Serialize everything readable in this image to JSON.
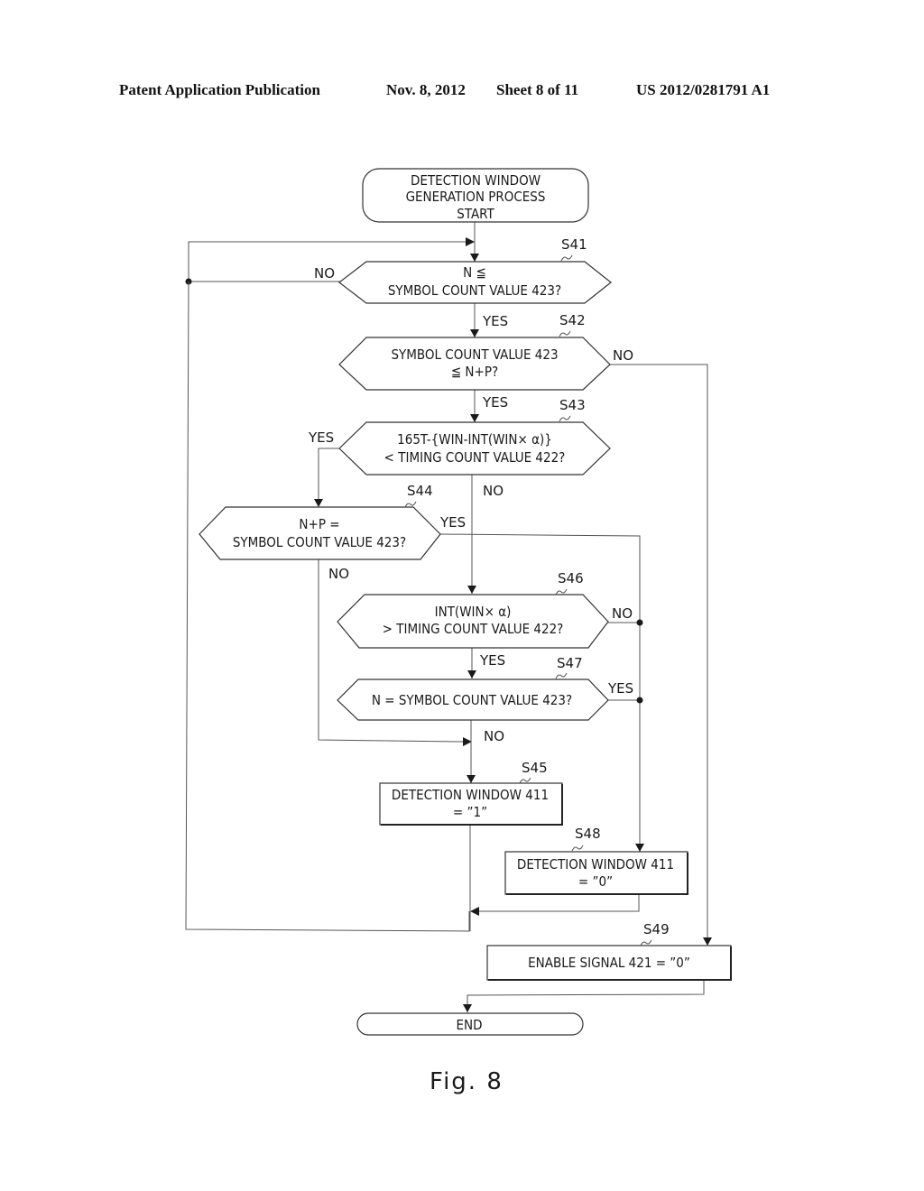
{
  "header": {
    "publication": "Patent Application Publication",
    "date": "Nov. 8, 2012",
    "sheet": "Sheet 8 of 11",
    "number": "US 2012/0281791 A1"
  },
  "flowchart": {
    "start": {
      "lines": [
        "DETECTION WINDOW",
        "GENERATION PROCESS",
        "START"
      ]
    },
    "steps": {
      "s41": {
        "id": "S41",
        "lines": [
          "N ≦",
          "SYMBOL COUNT VALUE 423?"
        ]
      },
      "s42": {
        "id": "S42",
        "lines": [
          "SYMBOL COUNT VALUE 423",
          "≦ N+P?"
        ]
      },
      "s43": {
        "id": "S43",
        "lines": [
          "165T-{WIN-INT(WIN× α)}",
          "< TIMING COUNT VALUE 422?"
        ]
      },
      "s44": {
        "id": "S44",
        "lines": [
          "N+P =",
          "SYMBOL COUNT VALUE 423?"
        ]
      },
      "s45": {
        "id": "S45",
        "lines": [
          "DETECTION WINDOW 411",
          "= ”1”"
        ]
      },
      "s46": {
        "id": "S46",
        "lines": [
          "INT(WIN× α)",
          "> TIMING COUNT VALUE 422?"
        ]
      },
      "s47": {
        "id": "S47",
        "lines": [
          "N = SYMBOL COUNT VALUE 423?"
        ]
      },
      "s48": {
        "id": "S48",
        "lines": [
          "DETECTION WINDOW 411",
          "= ”0”"
        ]
      },
      "s49": {
        "id": "S49",
        "lines": [
          "ENABLE SIGNAL 421 = ”0”"
        ]
      }
    },
    "end": {
      "label": "END"
    },
    "branch_labels": {
      "s41_no": "NO",
      "s41_yes": "YES",
      "s42_no": "NO",
      "s42_yes": "YES",
      "s43_yes": "YES",
      "s43_no": "NO",
      "s44_yes": "YES",
      "s44_no": "NO",
      "s46_no": "NO",
      "s46_yes": "YES",
      "s47_yes": "YES",
      "s47_no": "NO"
    }
  },
  "figure_caption": "Fig. 8"
}
